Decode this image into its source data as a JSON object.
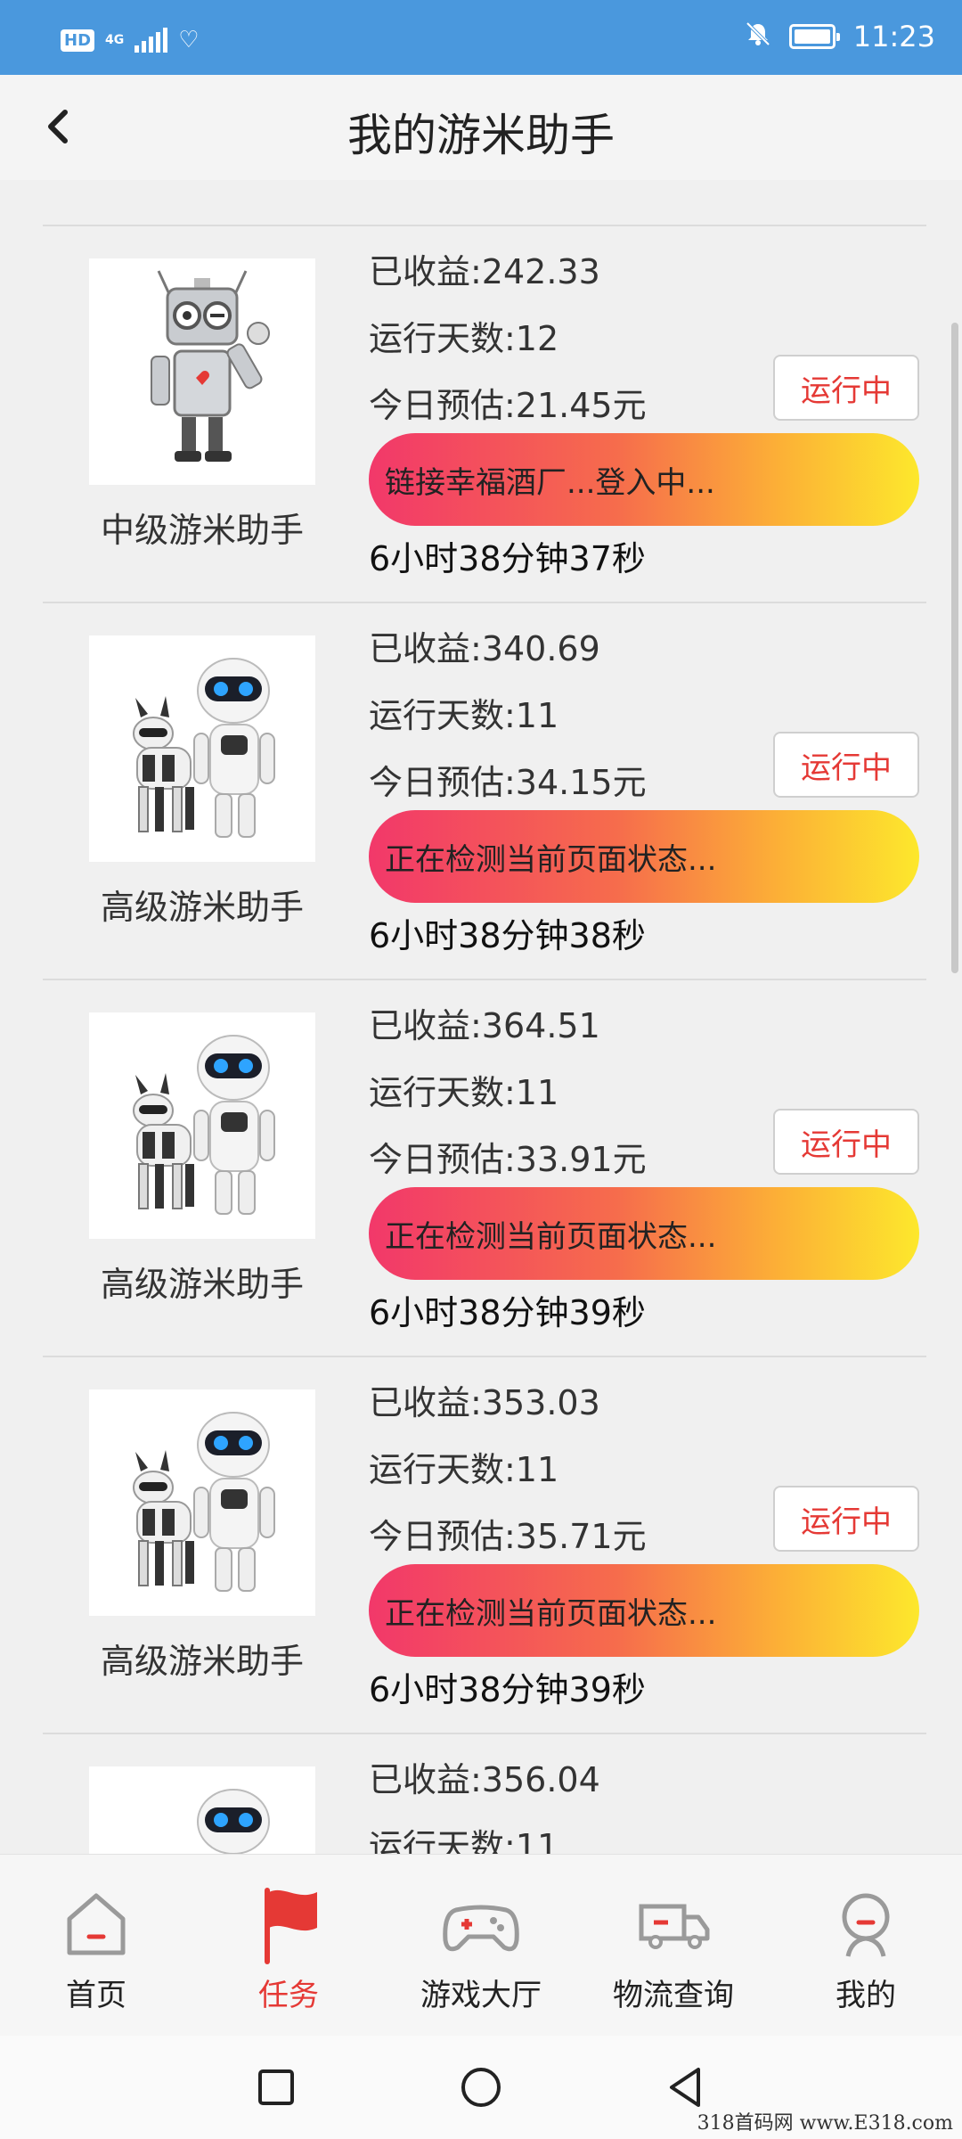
{
  "status_bar": {
    "hd": "HD",
    "network": "4G",
    "time": "11:23",
    "icons": [
      "hd-badge",
      "signal-icon",
      "heart-icon",
      "bell-off-icon",
      "battery-icon"
    ]
  },
  "header": {
    "title": "我的游米助手",
    "back_icon": "chevron-left-icon"
  },
  "colors": {
    "accent_red": "#e53935",
    "status_blue": "#4a98dd",
    "progress_start": "#f2386a",
    "progress_end": "#fde82c"
  },
  "assistants": [
    {
      "name": "中级游米助手",
      "robot": "classic",
      "earned": "已收益:242.33",
      "days": "运行天数:12",
      "estimate": "今日预估:21.45元",
      "status": "运行中",
      "progress_text": "链接幸福酒厂...登入中...",
      "timer": "6小时38分钟37秒"
    },
    {
      "name": "高级游米助手",
      "robot": "advanced",
      "earned": "已收益:340.69",
      "days": "运行天数:11",
      "estimate": "今日预估:34.15元",
      "status": "运行中",
      "progress_text": "正在检测当前页面状态...",
      "timer": "6小时38分钟38秒"
    },
    {
      "name": "高级游米助手",
      "robot": "advanced",
      "earned": "已收益:364.51",
      "days": "运行天数:11",
      "estimate": "今日预估:33.91元",
      "status": "运行中",
      "progress_text": "正在检测当前页面状态...",
      "timer": "6小时38分钟39秒"
    },
    {
      "name": "高级游米助手",
      "robot": "advanced",
      "earned": "已收益:353.03",
      "days": "运行天数:11",
      "estimate": "今日预估:35.71元",
      "status": "运行中",
      "progress_text": "正在检测当前页面状态...",
      "timer": "6小时38分钟39秒"
    },
    {
      "name": "",
      "robot": "advanced",
      "earned": "已收益:356.04",
      "days": "运行天数:11",
      "estimate": "",
      "status": "",
      "progress_text": "",
      "timer": ""
    }
  ],
  "tabs": [
    {
      "label": "首页",
      "icon": "home-icon",
      "active": false
    },
    {
      "label": "任务",
      "icon": "flag-icon",
      "active": true
    },
    {
      "label": "游戏大厅",
      "icon": "gamepad-icon",
      "active": false
    },
    {
      "label": "物流查询",
      "icon": "truck-icon",
      "active": false
    },
    {
      "label": "我的",
      "icon": "profile-icon",
      "active": false
    }
  ],
  "system_nav": [
    "recents-square-icon",
    "home-circle-icon",
    "back-triangle-icon"
  ],
  "watermark": "318首码网 www.E318.com"
}
